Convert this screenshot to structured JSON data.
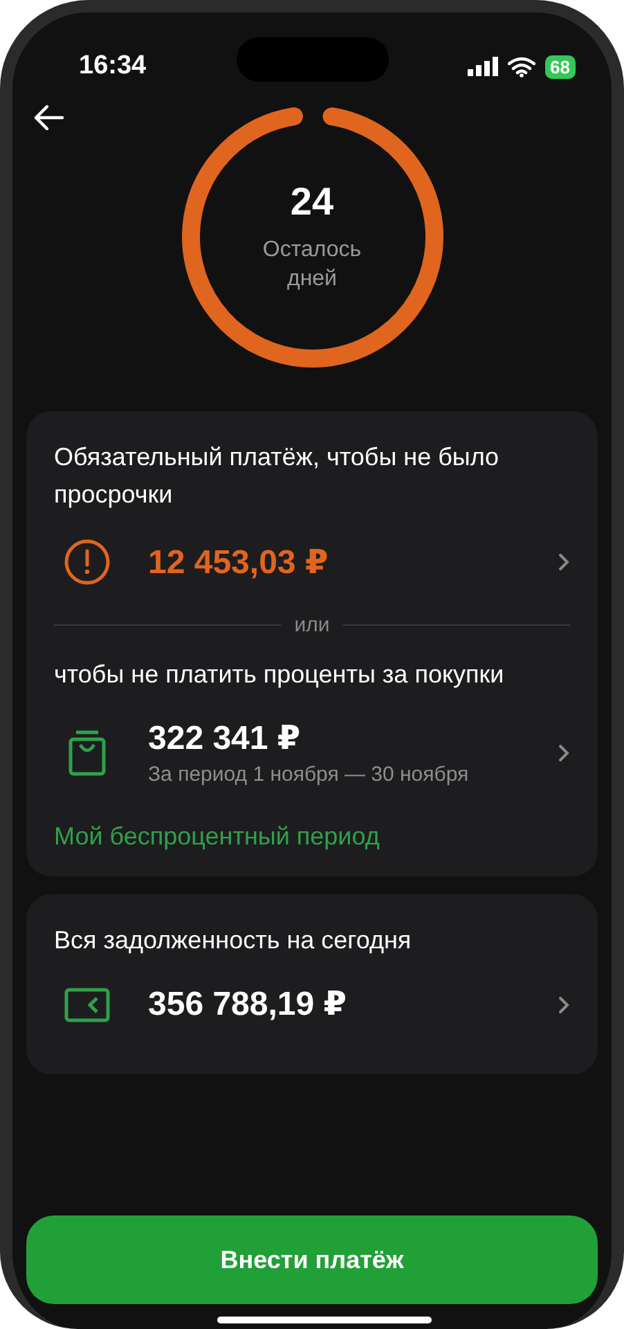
{
  "status_bar": {
    "time": "16:34",
    "battery": "68"
  },
  "countdown": {
    "level": 0.95,
    "value": "24",
    "caption": "Осталось дней"
  },
  "payment_card": {
    "sections": [
      {
        "title": "Обязательный платёж, чтобы не было просрочки",
        "kind": "alert",
        "amount": "12 453,03 ₽",
        "highlight": true
      },
      {
        "title": "чтобы не платить проценты за покупки",
        "kind": "bag",
        "amount": "322 341 ₽",
        "note": "За период 1 ноября — 30 ноября",
        "highlight": false
      }
    ],
    "divider": "или",
    "link": "Мой беспроцентный период"
  },
  "debt_card": {
    "title": "Вся задолженность на сегодня",
    "kind": "wallet",
    "amount": "356 788,19 ₽",
    "highlight": false
  },
  "pay_button": "Внести платёж"
}
